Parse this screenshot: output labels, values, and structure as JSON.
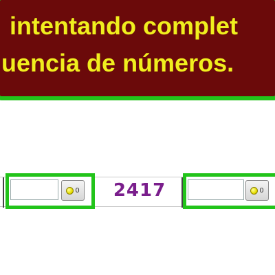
{
  "banner": {
    "line1": "intentando complet",
    "line2": "uencia de números.",
    "bg_color": "#6b0a0a",
    "text_color": "#f0ef1e",
    "border_color": "#22c41a"
  },
  "sequence": {
    "slots": [
      {
        "value": "",
        "hint_icon": "lightbulb-icon",
        "hint_count": "0"
      },
      {
        "value": "",
        "hint_icon": "lightbulb-icon",
        "hint_count": "0"
      }
    ],
    "given_number": "2417",
    "given_number_color": "#7a1e8c"
  }
}
